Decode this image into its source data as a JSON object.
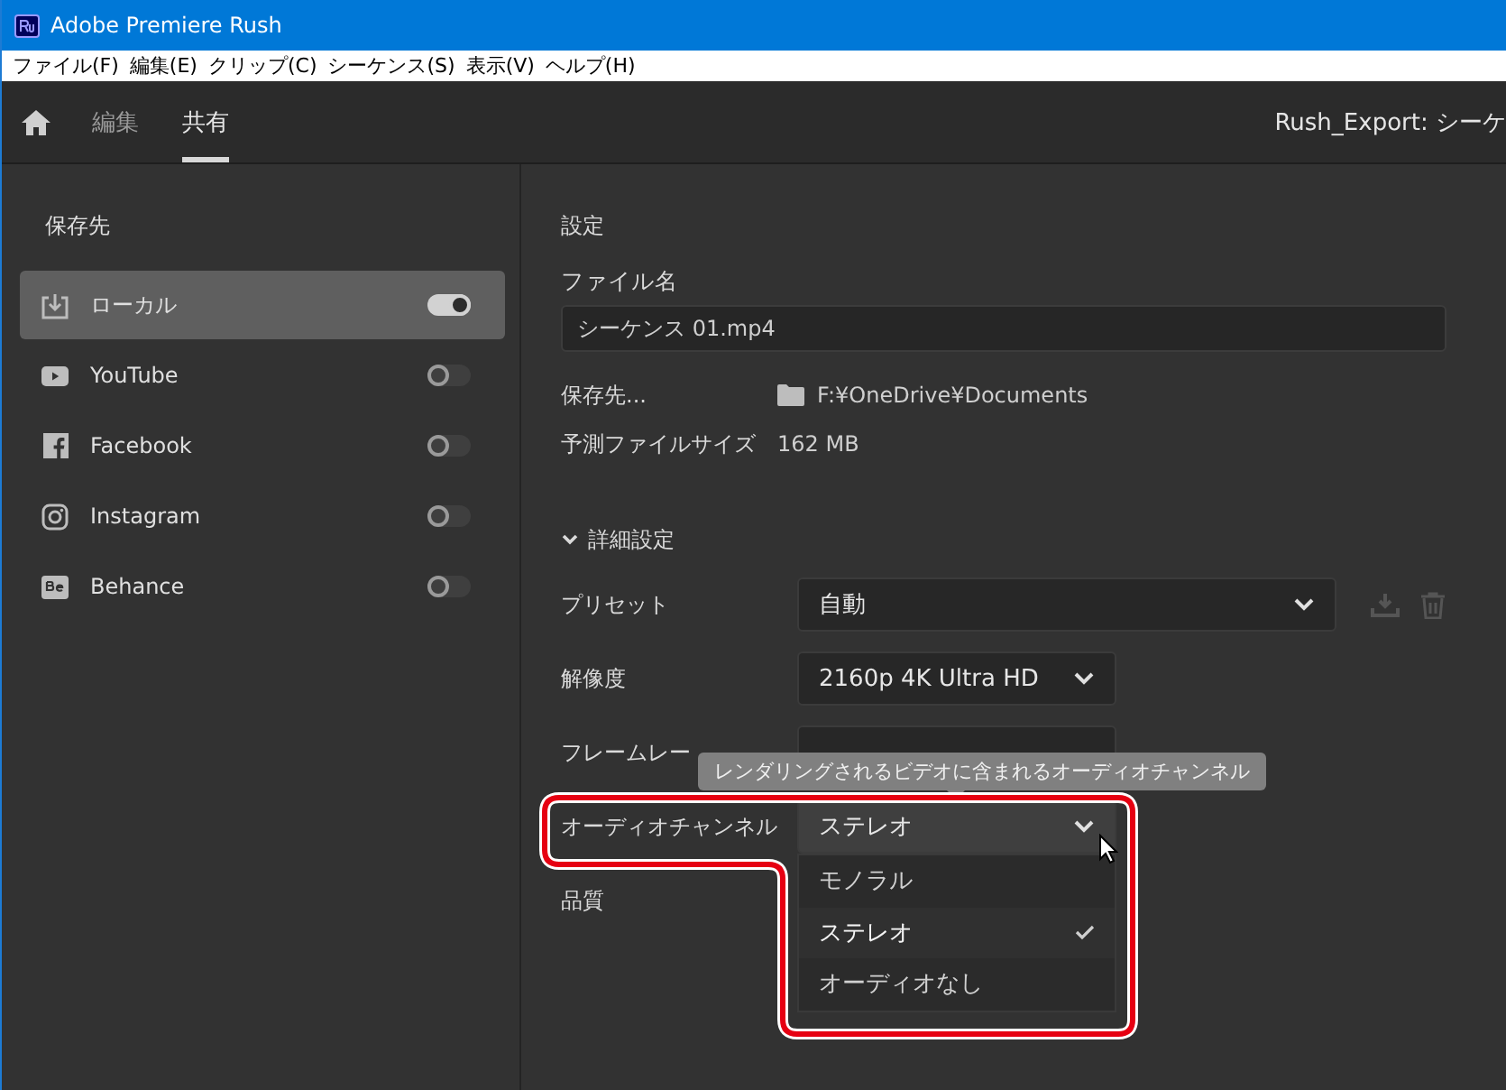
{
  "window": {
    "title": "Adobe Premiere Rush"
  },
  "menu": [
    "ファイル(F)",
    "編集(E)",
    "クリップ(C)",
    "シーケンス(S)",
    "表示(V)",
    "ヘルプ(H)"
  ],
  "header": {
    "tabs": [
      {
        "label": "編集",
        "selected": false
      },
      {
        "label": "共有",
        "selected": true
      }
    ],
    "project_title": "Rush_Export: シーケ"
  },
  "sidebar": {
    "heading": "保存先",
    "items": [
      {
        "label": "ローカル",
        "selected": true,
        "on": true
      },
      {
        "label": "YouTube",
        "selected": false,
        "on": false
      },
      {
        "label": "Facebook",
        "selected": false,
        "on": false
      },
      {
        "label": "Instagram",
        "selected": false,
        "on": false
      },
      {
        "label": "Behance",
        "selected": false,
        "on": false
      }
    ]
  },
  "settings": {
    "heading": "設定",
    "file_name_label": "ファイル名",
    "file_name": "シーケンス 01.mp4",
    "location_label": "保存先...",
    "location": "F:¥OneDrive¥Documents",
    "size_label": "予測ファイルサイズ",
    "size": "162 MB",
    "advanced": {
      "label": "詳細設定",
      "expanded": true
    },
    "rows": [
      {
        "kind": "preset",
        "label": "プリセット",
        "value": "自動"
      },
      {
        "kind": "select",
        "label": "解像度",
        "value": "2160p 4K Ultra HD"
      },
      {
        "kind": "covered",
        "label": "フレームレー"
      },
      {
        "kind": "open",
        "label": "オーディオチャンネル",
        "value": "ステレオ",
        "options": [
          {
            "label": "モノラル",
            "selected": false
          },
          {
            "label": "ステレオ",
            "selected": true
          },
          {
            "label": "オーディオなし",
            "selected": false
          }
        ]
      },
      {
        "kind": "label",
        "label": "品質"
      }
    ],
    "tooltip": "レンダリングされるビデオに含まれるオーディオチャンネル"
  }
}
